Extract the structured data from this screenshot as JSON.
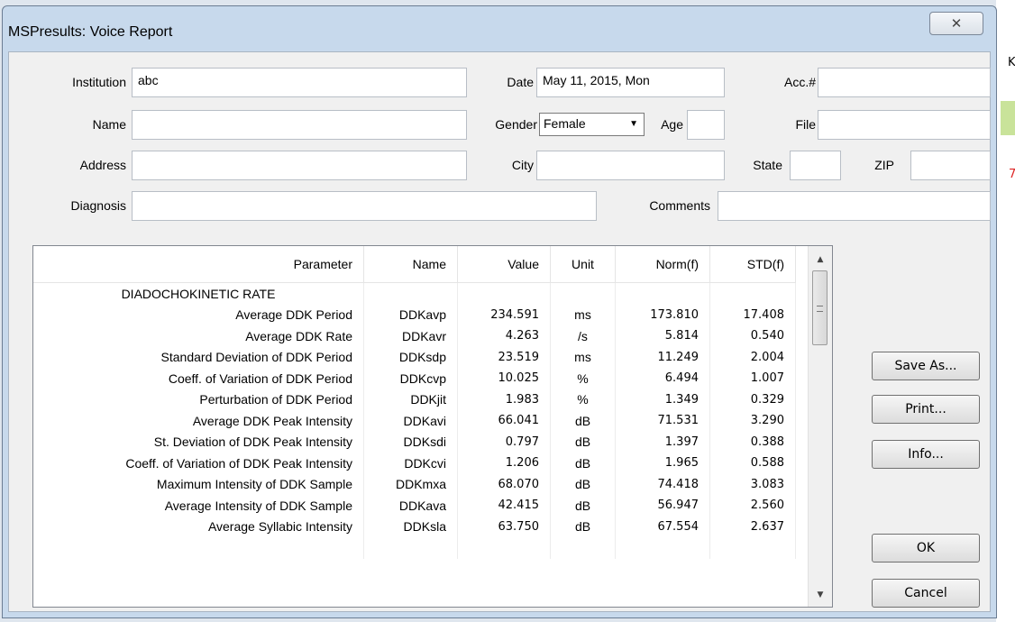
{
  "window": {
    "title": "MSPresults: Voice Report",
    "close_glyph": "✕"
  },
  "background": {
    "letter": "K",
    "red_mark": "7"
  },
  "form": {
    "institution": {
      "label": "Institution",
      "value": "abc"
    },
    "date": {
      "label": "Date",
      "value": "May 11, 2015, Mon"
    },
    "acc": {
      "label": "Acc.#",
      "value": ""
    },
    "name": {
      "label": "Name",
      "value": ""
    },
    "gender": {
      "label": "Gender",
      "value": "Female"
    },
    "age": {
      "label": "Age",
      "value": ""
    },
    "file": {
      "label": "File",
      "value": ""
    },
    "address": {
      "label": "Address",
      "value": ""
    },
    "city": {
      "label": "City",
      "value": ""
    },
    "state": {
      "label": "State",
      "value": ""
    },
    "zip": {
      "label": "ZIP",
      "value": ""
    },
    "diagnosis": {
      "label": "Diagnosis",
      "value": ""
    },
    "comments": {
      "label": "Comments",
      "value": ""
    }
  },
  "table": {
    "columns": [
      "Parameter",
      "Name",
      "Value",
      "Unit",
      "Norm(f)",
      "STD(f)"
    ],
    "rows": [
      [
        "DIADOCHOKINETIC RATE",
        "",
        "",
        "",
        "",
        ""
      ],
      [
        "Average DDK Period",
        "DDKavp",
        "234.591",
        "ms",
        "173.810",
        "17.408"
      ],
      [
        "Average DDK Rate",
        "DDKavr",
        "4.263",
        "/s",
        "5.814",
        "0.540"
      ],
      [
        "Standard Deviation of DDK Period",
        "DDKsdp",
        "23.519",
        "ms",
        "11.249",
        "2.004"
      ],
      [
        "Coeff. of Variation of DDK Period",
        "DDKcvp",
        "10.025",
        "%",
        "6.494",
        "1.007"
      ],
      [
        "Perturbation of DDK Period",
        "DDKjit",
        "1.983",
        "%",
        "1.349",
        "0.329"
      ],
      [
        "Average DDK Peak Intensity",
        "DDKavi",
        "66.041",
        "dB",
        "71.531",
        "3.290"
      ],
      [
        "St. Deviation of DDK Peak Intensity",
        "DDKsdi",
        "0.797",
        "dB",
        "1.397",
        "0.388"
      ],
      [
        "Coeff. of Variation of DDK Peak Intensity",
        "DDKcvi",
        "1.206",
        "dB",
        "1.965",
        "0.588"
      ],
      [
        "Maximum Intensity of DDK Sample",
        "DDKmxa",
        "68.070",
        "dB",
        "74.418",
        "3.083"
      ],
      [
        "Average Intensity of DDK Sample",
        "DDKava",
        "42.415",
        "dB",
        "56.947",
        "2.560"
      ],
      [
        "Average Syllabic Intensity",
        "DDKsla",
        "63.750",
        "dB",
        "67.554",
        "2.637"
      ],
      [
        "",
        "",
        "",
        "",
        "",
        ""
      ]
    ]
  },
  "buttons": {
    "save_as": "Save As...",
    "print": "Print...",
    "info": "Info...",
    "ok": "OK",
    "cancel": "Cancel"
  }
}
